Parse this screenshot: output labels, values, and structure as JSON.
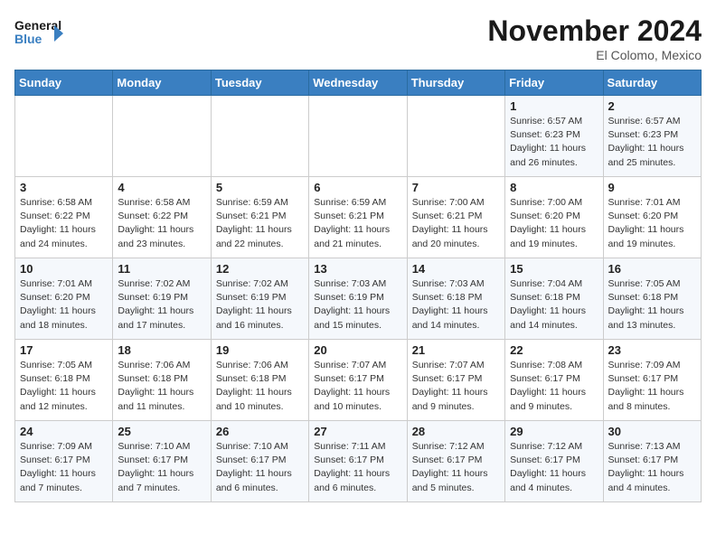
{
  "header": {
    "logo_line1": "General",
    "logo_line2": "Blue",
    "month": "November 2024",
    "location": "El Colomo, Mexico"
  },
  "days_of_week": [
    "Sunday",
    "Monday",
    "Tuesday",
    "Wednesday",
    "Thursday",
    "Friday",
    "Saturday"
  ],
  "weeks": [
    [
      {
        "day": "",
        "info": ""
      },
      {
        "day": "",
        "info": ""
      },
      {
        "day": "",
        "info": ""
      },
      {
        "day": "",
        "info": ""
      },
      {
        "day": "",
        "info": ""
      },
      {
        "day": "1",
        "info": "Sunrise: 6:57 AM\nSunset: 6:23 PM\nDaylight: 11 hours and 26 minutes."
      },
      {
        "day": "2",
        "info": "Sunrise: 6:57 AM\nSunset: 6:23 PM\nDaylight: 11 hours and 25 minutes."
      }
    ],
    [
      {
        "day": "3",
        "info": "Sunrise: 6:58 AM\nSunset: 6:22 PM\nDaylight: 11 hours and 24 minutes."
      },
      {
        "day": "4",
        "info": "Sunrise: 6:58 AM\nSunset: 6:22 PM\nDaylight: 11 hours and 23 minutes."
      },
      {
        "day": "5",
        "info": "Sunrise: 6:59 AM\nSunset: 6:21 PM\nDaylight: 11 hours and 22 minutes."
      },
      {
        "day": "6",
        "info": "Sunrise: 6:59 AM\nSunset: 6:21 PM\nDaylight: 11 hours and 21 minutes."
      },
      {
        "day": "7",
        "info": "Sunrise: 7:00 AM\nSunset: 6:21 PM\nDaylight: 11 hours and 20 minutes."
      },
      {
        "day": "8",
        "info": "Sunrise: 7:00 AM\nSunset: 6:20 PM\nDaylight: 11 hours and 19 minutes."
      },
      {
        "day": "9",
        "info": "Sunrise: 7:01 AM\nSunset: 6:20 PM\nDaylight: 11 hours and 19 minutes."
      }
    ],
    [
      {
        "day": "10",
        "info": "Sunrise: 7:01 AM\nSunset: 6:20 PM\nDaylight: 11 hours and 18 minutes."
      },
      {
        "day": "11",
        "info": "Sunrise: 7:02 AM\nSunset: 6:19 PM\nDaylight: 11 hours and 17 minutes."
      },
      {
        "day": "12",
        "info": "Sunrise: 7:02 AM\nSunset: 6:19 PM\nDaylight: 11 hours and 16 minutes."
      },
      {
        "day": "13",
        "info": "Sunrise: 7:03 AM\nSunset: 6:19 PM\nDaylight: 11 hours and 15 minutes."
      },
      {
        "day": "14",
        "info": "Sunrise: 7:03 AM\nSunset: 6:18 PM\nDaylight: 11 hours and 14 minutes."
      },
      {
        "day": "15",
        "info": "Sunrise: 7:04 AM\nSunset: 6:18 PM\nDaylight: 11 hours and 14 minutes."
      },
      {
        "day": "16",
        "info": "Sunrise: 7:05 AM\nSunset: 6:18 PM\nDaylight: 11 hours and 13 minutes."
      }
    ],
    [
      {
        "day": "17",
        "info": "Sunrise: 7:05 AM\nSunset: 6:18 PM\nDaylight: 11 hours and 12 minutes."
      },
      {
        "day": "18",
        "info": "Sunrise: 7:06 AM\nSunset: 6:18 PM\nDaylight: 11 hours and 11 minutes."
      },
      {
        "day": "19",
        "info": "Sunrise: 7:06 AM\nSunset: 6:18 PM\nDaylight: 11 hours and 10 minutes."
      },
      {
        "day": "20",
        "info": "Sunrise: 7:07 AM\nSunset: 6:17 PM\nDaylight: 11 hours and 10 minutes."
      },
      {
        "day": "21",
        "info": "Sunrise: 7:07 AM\nSunset: 6:17 PM\nDaylight: 11 hours and 9 minutes."
      },
      {
        "day": "22",
        "info": "Sunrise: 7:08 AM\nSunset: 6:17 PM\nDaylight: 11 hours and 9 minutes."
      },
      {
        "day": "23",
        "info": "Sunrise: 7:09 AM\nSunset: 6:17 PM\nDaylight: 11 hours and 8 minutes."
      }
    ],
    [
      {
        "day": "24",
        "info": "Sunrise: 7:09 AM\nSunset: 6:17 PM\nDaylight: 11 hours and 7 minutes."
      },
      {
        "day": "25",
        "info": "Sunrise: 7:10 AM\nSunset: 6:17 PM\nDaylight: 11 hours and 7 minutes."
      },
      {
        "day": "26",
        "info": "Sunrise: 7:10 AM\nSunset: 6:17 PM\nDaylight: 11 hours and 6 minutes."
      },
      {
        "day": "27",
        "info": "Sunrise: 7:11 AM\nSunset: 6:17 PM\nDaylight: 11 hours and 6 minutes."
      },
      {
        "day": "28",
        "info": "Sunrise: 7:12 AM\nSunset: 6:17 PM\nDaylight: 11 hours and 5 minutes."
      },
      {
        "day": "29",
        "info": "Sunrise: 7:12 AM\nSunset: 6:17 PM\nDaylight: 11 hours and 4 minutes."
      },
      {
        "day": "30",
        "info": "Sunrise: 7:13 AM\nSunset: 6:17 PM\nDaylight: 11 hours and 4 minutes."
      }
    ]
  ]
}
